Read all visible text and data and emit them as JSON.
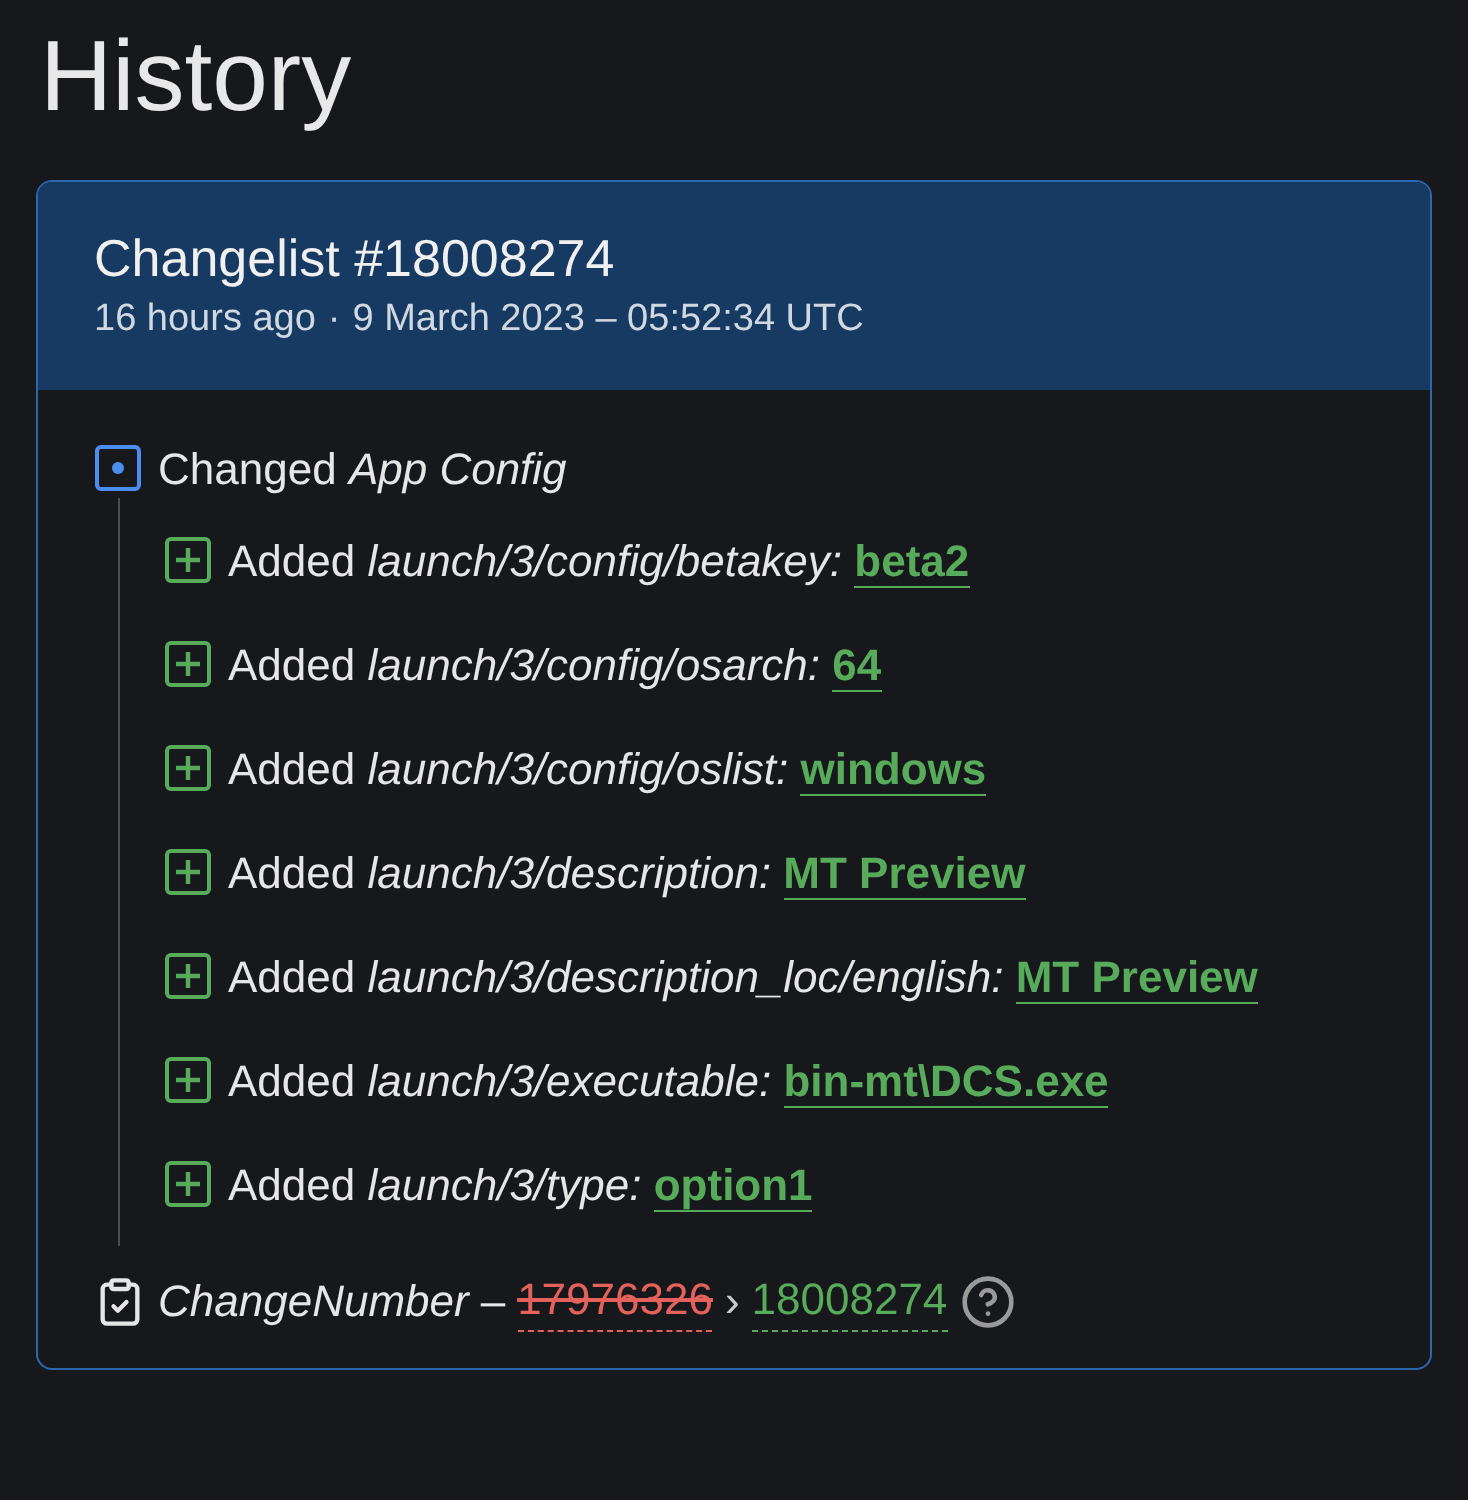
{
  "page_title": "History",
  "changelist": {
    "title": "Changelist #18008274",
    "relative_time": "16 hours ago",
    "separator": "·",
    "timestamp": "9 March 2023 – 05:52:34 UTC"
  },
  "group": {
    "kind": "changed",
    "action": "Changed",
    "target": "App Config",
    "children": [
      {
        "kind": "added",
        "action": "Added",
        "key": "launch/3/config/betakey:",
        "value": "beta2"
      },
      {
        "kind": "added",
        "action": "Added",
        "key": "launch/3/config/osarch:",
        "value": "64"
      },
      {
        "kind": "added",
        "action": "Added",
        "key": "launch/3/config/oslist:",
        "value": "windows"
      },
      {
        "kind": "added",
        "action": "Added",
        "key": "launch/3/description:",
        "value": "MT Preview"
      },
      {
        "kind": "added",
        "action": "Added",
        "key": "launch/3/description_loc/english:",
        "value": "MT Preview"
      },
      {
        "kind": "added",
        "action": "Added",
        "key": "launch/3/executable:",
        "value": "bin-mt\\DCS.exe"
      },
      {
        "kind": "added",
        "action": "Added",
        "key": "launch/3/type:",
        "value": "option1"
      }
    ]
  },
  "change_number": {
    "key": "ChangeNumber",
    "dash": "–",
    "old_value": "17976326",
    "arrow": "›",
    "new_value": "18008274"
  }
}
